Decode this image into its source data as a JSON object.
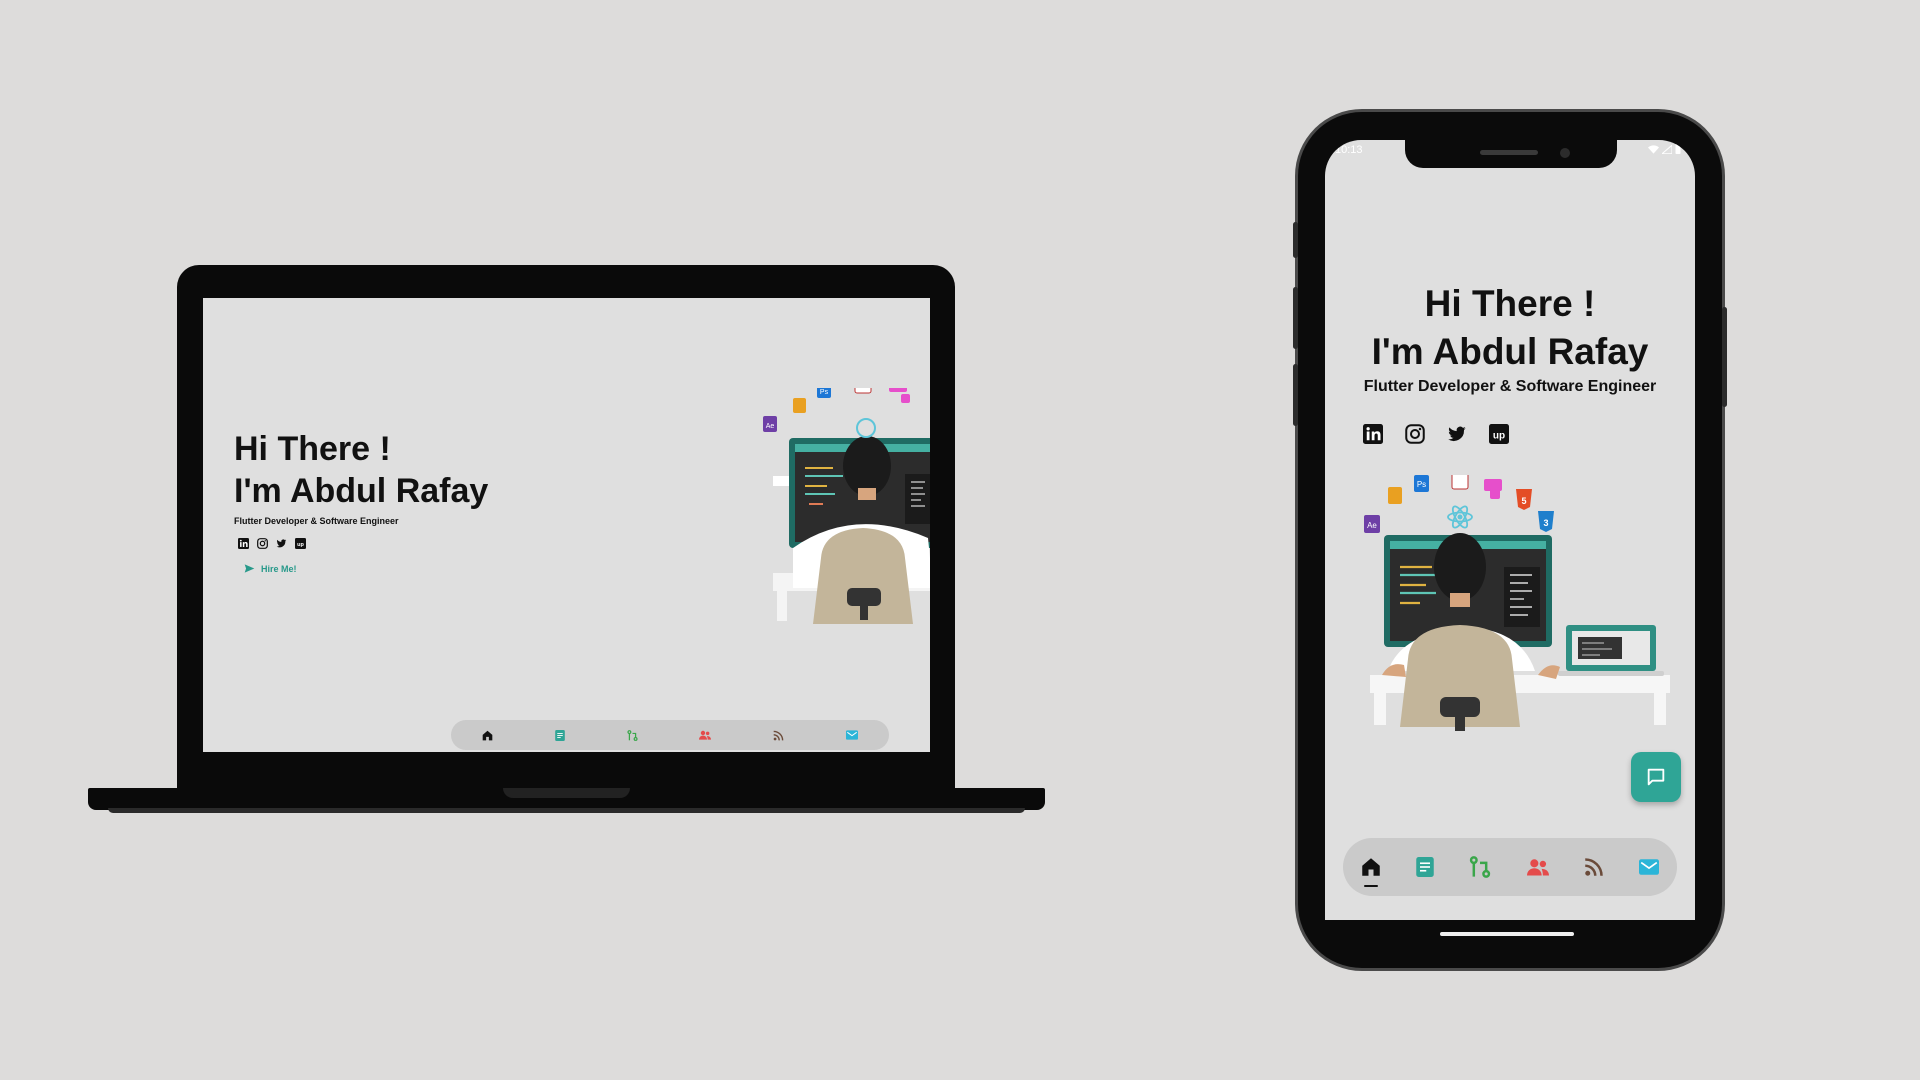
{
  "hero": {
    "greeting": "Hi There !",
    "name": "I'm Abdul Rafay",
    "subtitle": "Flutter Developer & Software Engineer",
    "hire_label": "Hire Me!"
  },
  "social": [
    "linkedin-icon",
    "instagram-icon",
    "twitter-icon",
    "upwork-icon"
  ],
  "nav": [
    "home-icon",
    "document-icon",
    "git-icon",
    "users-icon",
    "rss-icon",
    "mail-icon"
  ],
  "status": {
    "time": "10:13"
  },
  "colors": {
    "accent": "#2fa596",
    "background": "#dfdfdf",
    "nav_bg": "#cacaca"
  }
}
